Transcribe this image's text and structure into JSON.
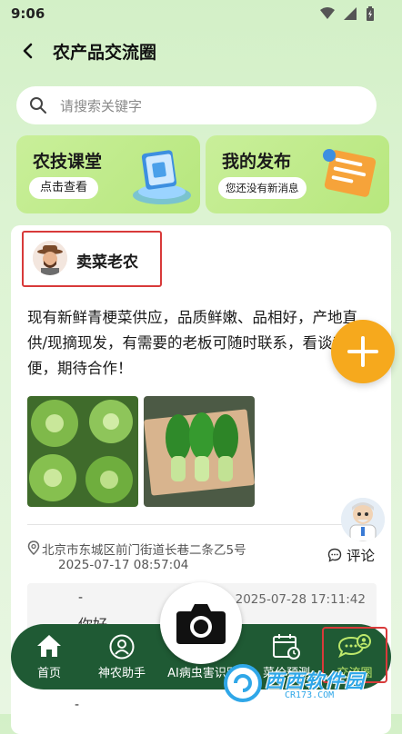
{
  "status_bar": {
    "time": "9:06"
  },
  "header": {
    "title": "农产品交流圈"
  },
  "search": {
    "placeholder": "请搜索关键字"
  },
  "cards": [
    {
      "title": "农技课堂",
      "button": "点击查看"
    },
    {
      "title": "我的发布",
      "subtitle": "您还没有新消息"
    }
  ],
  "post": {
    "author": "卖菜老农",
    "content": "现有新鲜青梗菜供应，品质鲜嫩、品相好，产地直供/现摘现发，有需要的老板可随时联系，看谈都方便，期待合作！",
    "location": "北京市东城区前门街道长巷二条乙5号",
    "date": "2025-07-17 08:57:04",
    "comment_label": "评论",
    "reply": {
      "name": "-",
      "time": "2025-07-28 17:11:42",
      "text": "你好"
    },
    "reply2_name": "-"
  },
  "tabbar": {
    "items": [
      {
        "label": "首页"
      },
      {
        "label": "神农助手"
      },
      {
        "label": "AI病虫害识别"
      },
      {
        "label": "菜价预测"
      },
      {
        "label": "交流圈"
      }
    ],
    "active": "交流圈"
  },
  "watermark": {
    "text": "西西软件园",
    "url": "CR173.COM"
  },
  "colors": {
    "accent": "#1f5a34",
    "fab": "#f6a91d",
    "highlight": "#d83a3a"
  }
}
